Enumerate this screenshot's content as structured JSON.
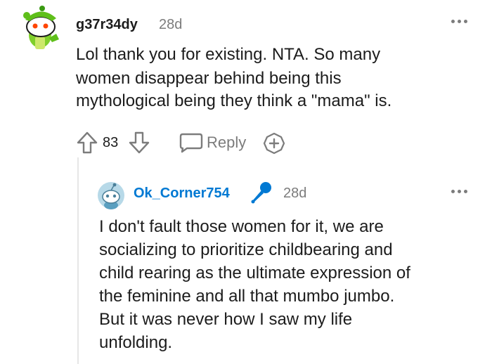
{
  "comment": {
    "username": "g37r34dy",
    "age": "28d",
    "body_lines": [
      "Lol thank you for existing. NTA. So many",
      "women disappear behind being this",
      "mythological being they think a \"mama\" is."
    ],
    "score": "83",
    "reply_label": "Reply",
    "avatar_icon": "snoo-avatar-green-hat",
    "accent_color": "#1c1c1c"
  },
  "reply": {
    "username": "Ok_Corner754",
    "age": "28d",
    "username_color": "#0079d3",
    "badge_icon": "microphone-icon",
    "body_lines": [
      "I don't fault those women for it, we are",
      "socializing to prioritize childbearing and",
      "child rearing as the ultimate expression of",
      "the feminine and all that mumbo jumbo.",
      "But it was never how I saw my life",
      "unfolding."
    ]
  }
}
